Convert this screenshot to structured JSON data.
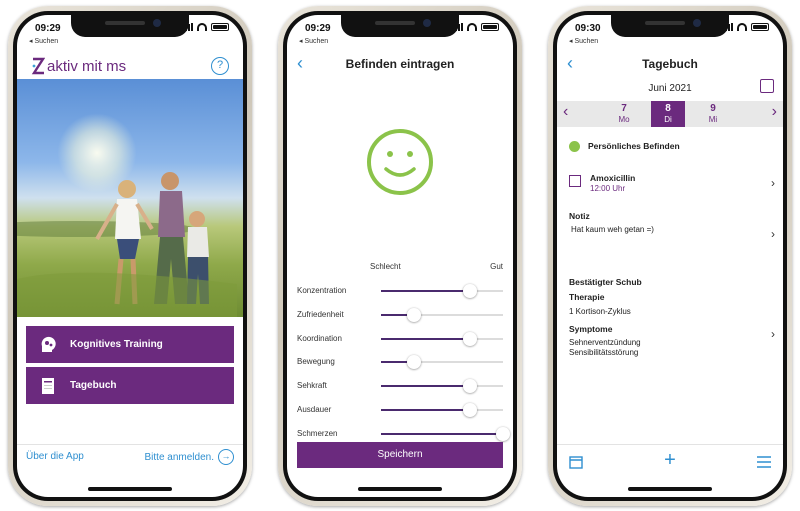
{
  "phone1": {
    "time": "09:29",
    "back_label": "◂ Suchen",
    "logo_text": "aktiv mit ms",
    "help_label": "?",
    "buttons": [
      {
        "label": "Kognitives Training",
        "icon": "brain-head-icon"
      },
      {
        "label": "Tagebuch",
        "icon": "notebook-icon"
      }
    ],
    "footer_left": "Über die App",
    "footer_right": "Bitte anmelden."
  },
  "phone2": {
    "time": "09:29",
    "back_label": "◂ Suchen",
    "title": "Befinden eintragen",
    "scale_low": "Schlecht",
    "scale_high": "Gut",
    "sliders": [
      {
        "name": "Konzentration",
        "value": 0.73
      },
      {
        "name": "Zufriedenheit",
        "value": 0.27
      },
      {
        "name": "Koordination",
        "value": 0.73
      },
      {
        "name": "Bewegung",
        "value": 0.27
      },
      {
        "name": "Sehkraft",
        "value": 0.73
      },
      {
        "name": "Ausdauer",
        "value": 0.73
      },
      {
        "name": "Schmerzen",
        "value": 1.0
      }
    ],
    "save_label": "Speichern",
    "mood_icon": "smiley-face-icon",
    "accent": "#8bc34a"
  },
  "phone3": {
    "time": "09:30",
    "back_label": "◂ Suchen",
    "title": "Tagebuch",
    "month": "Juni 2021",
    "days": [
      {
        "num": "7",
        "wd": "Mo",
        "selected": false
      },
      {
        "num": "8",
        "wd": "Di",
        "selected": true
      },
      {
        "num": "9",
        "wd": "Mi",
        "selected": false
      }
    ],
    "befinden_label": "Persönliches Befinden",
    "medication": {
      "name": "Amoxicillin",
      "time": "12:00 Uhr"
    },
    "notiz_label": "Notiz",
    "notiz_text": "Hat kaum weh getan =)",
    "schub_label": "Bestätigter Schub",
    "therapie_label": "Therapie",
    "therapie_value": "1 Kortison-Zyklus",
    "symptome_label": "Symptome",
    "symptome_values": [
      "Sehnerventzündung",
      "Sensibilitätsstörung"
    ]
  },
  "colors": {
    "brand": "#6b2a7e",
    "link": "#2f8fd0",
    "good": "#8bc34a"
  }
}
